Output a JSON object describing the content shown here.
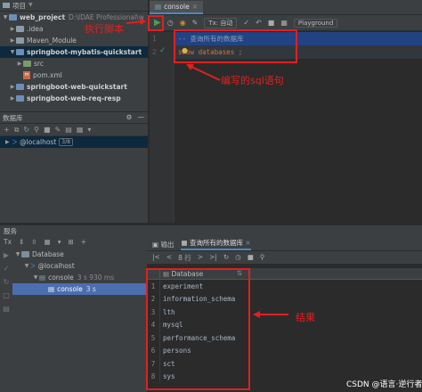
{
  "project": {
    "header_label": "项目",
    "tree": [
      {
        "label": "web_project",
        "hint": "D:\\IDAE Professional\\w",
        "level": 0,
        "bold": true
      },
      {
        "label": ".idea",
        "level": 1
      },
      {
        "label": "Maven_Module",
        "level": 1
      },
      {
        "label": "springboot-mybatis-quickstart",
        "level": 1,
        "bold": true,
        "selected": true
      },
      {
        "label": "src",
        "level": 2
      },
      {
        "label": "pom.xml",
        "level": 2
      },
      {
        "label": "springboot-web-quickstart",
        "level": 1,
        "bold": true
      },
      {
        "label": "springboot-web-req-resp",
        "level": 1,
        "bold": true
      }
    ]
  },
  "database": {
    "header_label": "数据库",
    "host": "@localhost",
    "count": "3/8"
  },
  "editor": {
    "tab_label": "console",
    "tx_label": "Tx: 自动",
    "playground_label": "Playground",
    "lines": [
      {
        "num": "1",
        "text": "-- 查询所有的数据库"
      },
      {
        "num": "2",
        "text": "show databases ;"
      }
    ]
  },
  "services": {
    "header_label": "服务",
    "tree": [
      {
        "label": "Database",
        "level": 0
      },
      {
        "label": "@localhost",
        "level": 1
      },
      {
        "label": "console",
        "hint": "3 s 930 ms",
        "level": 2
      },
      {
        "label": "console",
        "hint": "3 s",
        "level": 3,
        "selected": true
      }
    ],
    "tabs": [
      "输出",
      "查询所有的数据库"
    ],
    "row_count": "8 行",
    "result_column": "Database",
    "rows": [
      "experiment",
      "information_schema",
      "lth",
      "mysql",
      "performance_schema",
      "persons",
      "sct",
      "sys"
    ]
  },
  "annotations": {
    "run_label": "执行脚本",
    "sql_label": "编写的sql语句",
    "result_label": "结果",
    "color": "#e02020"
  },
  "watermark": "CSDN @语言·逆行者"
}
